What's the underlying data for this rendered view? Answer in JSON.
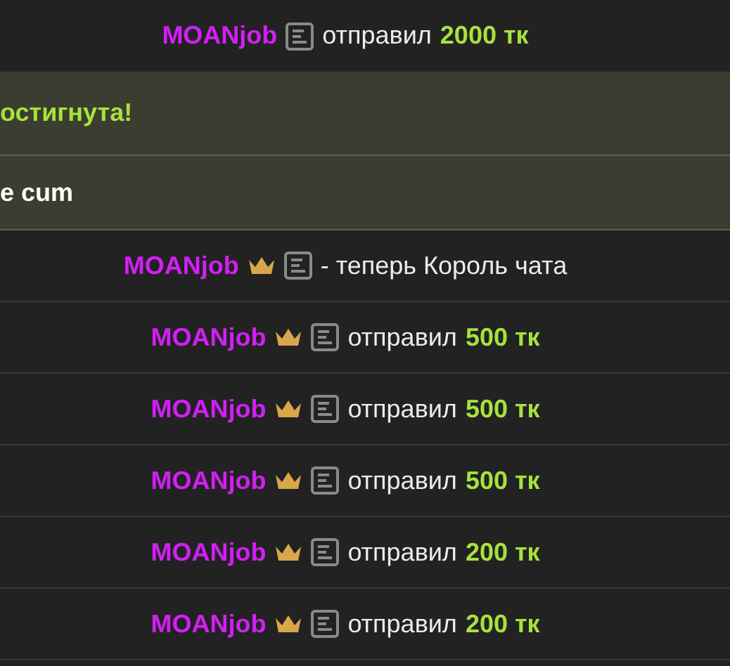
{
  "messages": [
    {
      "kind": "tip",
      "user": "MOANjob",
      "crown": false,
      "text": "отправил",
      "amount": "2000 тк"
    },
    {
      "kind": "notice",
      "text": "остигнута!",
      "color": "#a6e23c"
    },
    {
      "kind": "notice",
      "text": "e cum",
      "color": "#ffffff"
    },
    {
      "kind": "status",
      "user": "MOANjob",
      "crown": true,
      "text": "- теперь Король чата"
    },
    {
      "kind": "tip",
      "user": "MOANjob",
      "crown": true,
      "text": "отправил",
      "amount": "500 тк"
    },
    {
      "kind": "tip",
      "user": "MOANjob",
      "crown": true,
      "text": "отправил",
      "amount": "500 тк"
    },
    {
      "kind": "tip",
      "user": "MOANjob",
      "crown": true,
      "text": "отправил",
      "amount": "500 тк"
    },
    {
      "kind": "tip",
      "user": "MOANjob",
      "crown": true,
      "text": "отправил",
      "amount": "200 тк"
    },
    {
      "kind": "tip",
      "user": "MOANjob",
      "crown": true,
      "text": "отправил",
      "amount": "200 тк"
    }
  ]
}
